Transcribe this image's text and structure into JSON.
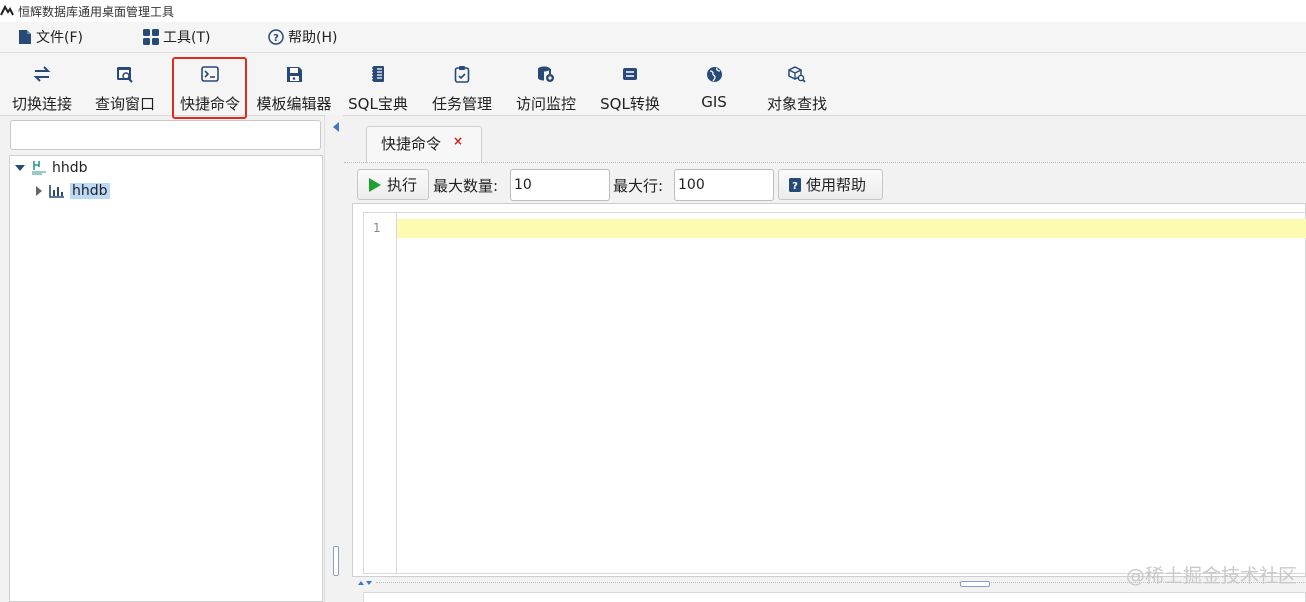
{
  "app": {
    "title": "恒辉数据库通用桌面管理工具"
  },
  "menu": [
    {
      "label": "文件(F)",
      "icon": "file-icon"
    },
    {
      "label": "工具(T)",
      "icon": "grid-icon"
    },
    {
      "label": "帮助(H)",
      "icon": "help-icon"
    }
  ],
  "toolbar": [
    {
      "label": "切换连接",
      "icon": "switch-icon"
    },
    {
      "label": "查询窗口",
      "icon": "query-window-icon"
    },
    {
      "label": "快捷命令",
      "icon": "terminal-icon",
      "highlighted": true
    },
    {
      "label": "模板编辑器",
      "icon": "save-template-icon"
    },
    {
      "label": "SQL宝典",
      "icon": "book-icon"
    },
    {
      "label": "任务管理",
      "icon": "clipboard-check-icon"
    },
    {
      "label": "访问监控",
      "icon": "database-monitor-icon"
    },
    {
      "label": "SQL转换",
      "icon": "convert-icon"
    },
    {
      "label": "GIS",
      "icon": "globe-icon"
    },
    {
      "label": "对象查找",
      "icon": "cube-search-icon"
    }
  ],
  "tree": {
    "root": {
      "label": "hhdb",
      "expanded": true,
      "icon": "server-logo-icon"
    },
    "child": {
      "label": "hhdb",
      "expanded": false,
      "selected": true,
      "icon": "bar-chart-icon"
    }
  },
  "tab": {
    "label": "快捷命令",
    "close_glyph": "×"
  },
  "command_bar": {
    "run_label": "执行",
    "max_count_label": "最大数量:",
    "max_count_value": "10",
    "max_rows_label": "最大行:",
    "max_rows_value": "100",
    "help_label": "使用帮助"
  },
  "editor": {
    "line_number": "1",
    "content": ""
  },
  "watermark": "@稀土掘金技术社区",
  "colors": {
    "highlight_border": "#e02a1e",
    "run_green": "#1fa12f",
    "active_line": "#fdfbb0",
    "selection": "#bcd9f7",
    "icon_blue": "#274a78"
  }
}
